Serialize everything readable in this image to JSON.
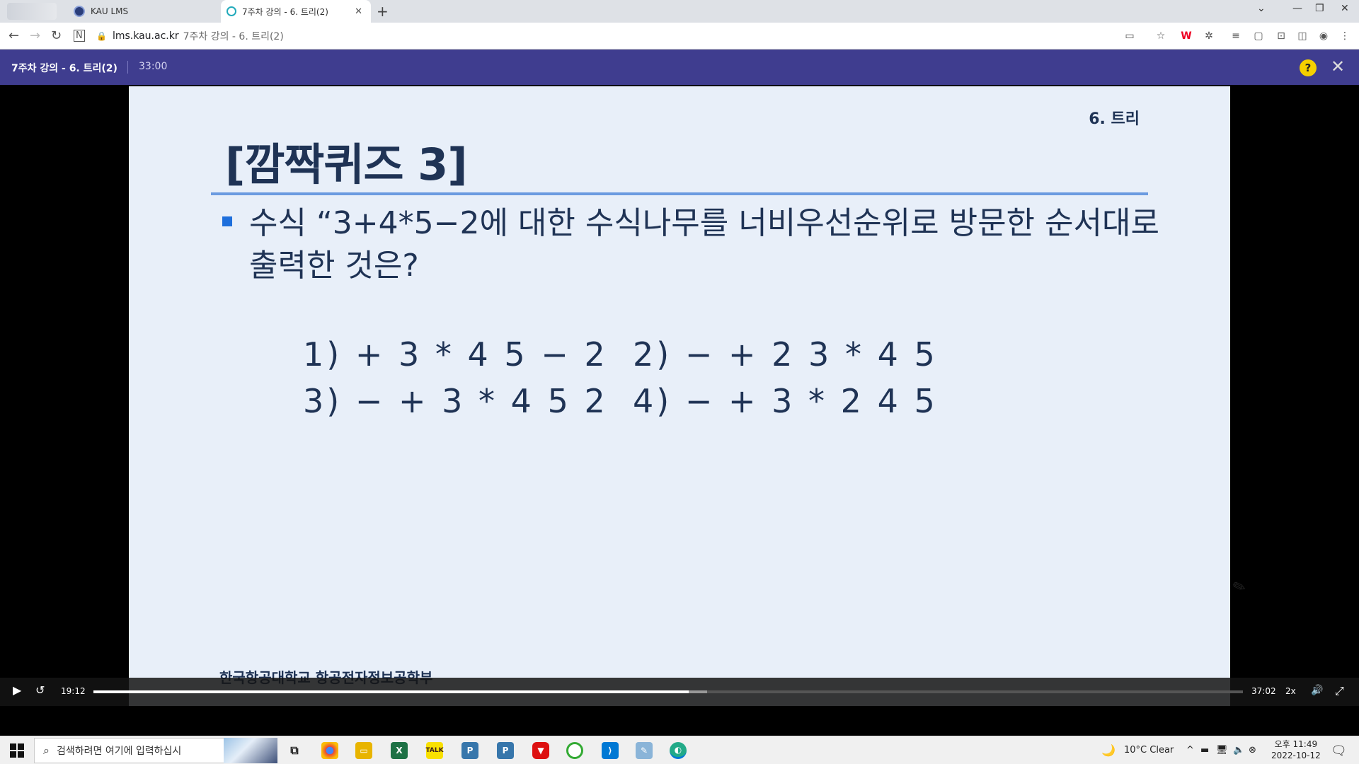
{
  "browser": {
    "tabs": [
      {
        "label": "KAU LMS"
      },
      {
        "label": "7주차 강의 - 6. 트리(2)"
      }
    ],
    "url_host": "lms.kau.ac.kr",
    "url_title": "7주차 강의 - 6. 트리(2)"
  },
  "player": {
    "title": "7주차 강의 - 6. 트리(2)",
    "duration": "33:00",
    "help_label": "?"
  },
  "slide": {
    "corner_label": "6. 트리",
    "title": "[깜짝퀴즈 3]",
    "question": "수식 “3+4*5−2에 대한 수식나무를 너비우선순위로 방문한 순서대로 출력한 것은?",
    "options": [
      "1) + 3 * 4 5 − 2",
      "2) − + 2 3 * 4 5",
      "3) − + 3 * 4 5 2",
      "4) − + 3 * 2 4 5"
    ],
    "footer": "한국항공대학교 항공전자정보공학부"
  },
  "controls": {
    "current_time": "19:12",
    "total_time": "37:02",
    "speed": "2x",
    "played_fraction": 0.518,
    "buffered_fraction": 0.534
  },
  "taskbar": {
    "search_placeholder": "검색하려면 여기에 입력하십시",
    "weather": "10°C  Clear",
    "time": "오후 11:49",
    "date": "2022-10-12"
  },
  "icons": {
    "back": "back-arrow-icon",
    "forward": "forward-arrow-icon",
    "reload": "reload-icon",
    "play": "play-icon",
    "rewind": "rewind-10-icon",
    "volume": "volume-icon",
    "fullscreen": "fullscreen-icon"
  }
}
